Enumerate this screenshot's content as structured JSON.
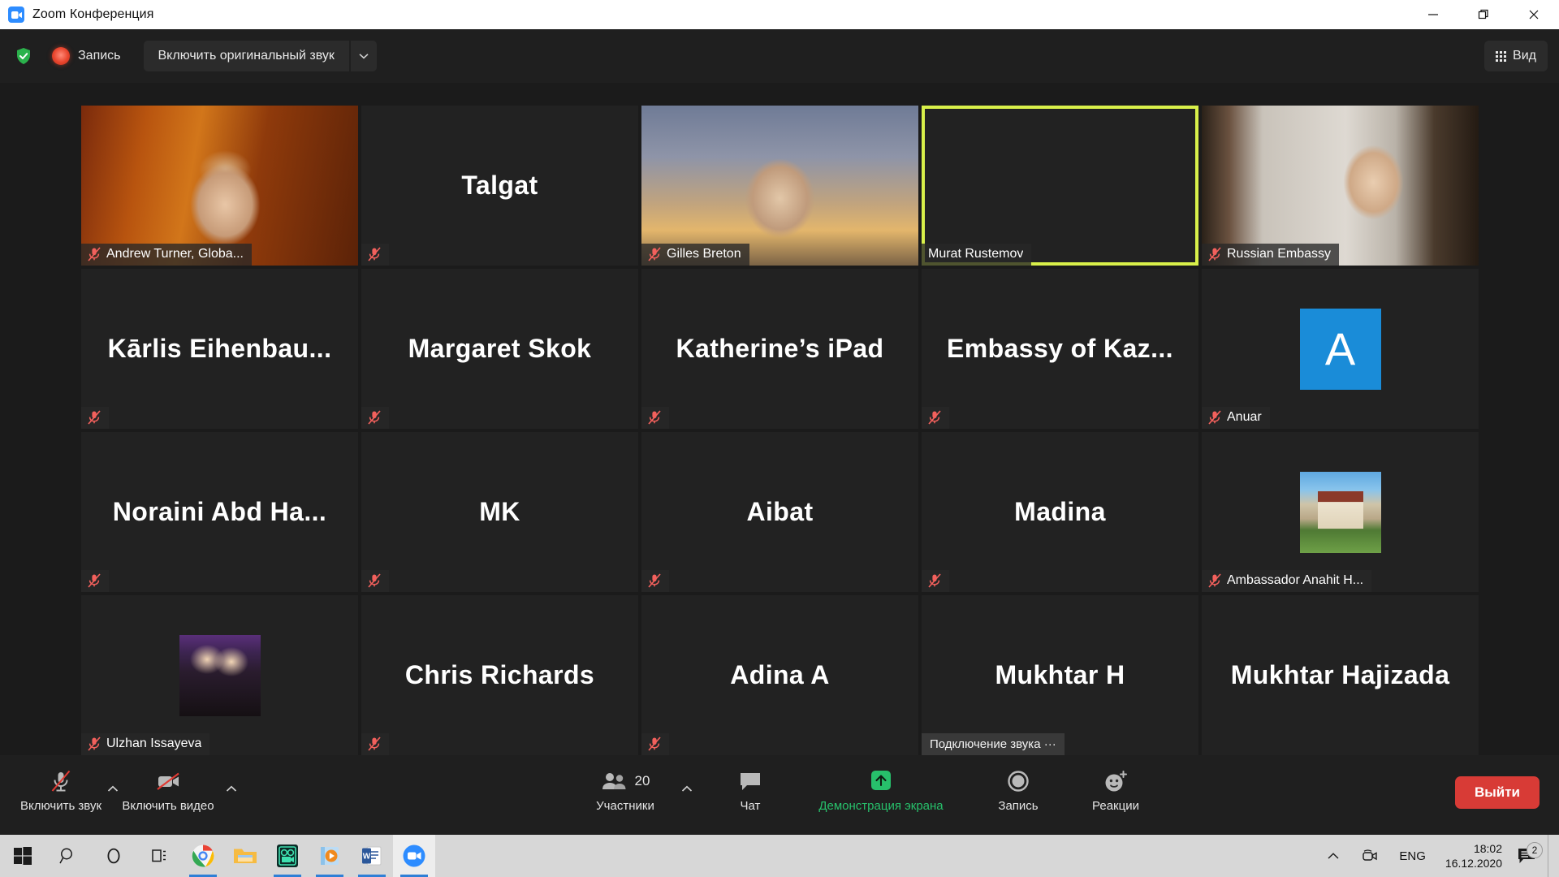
{
  "window": {
    "title": "Zoom Конференция",
    "app_icon": "zoom-camera-icon",
    "minimize_label": "Свернуть",
    "restore_label": "Развернуть",
    "close_label": "Закрыть"
  },
  "toolbar": {
    "shield_icon": "shield-check-icon",
    "recording_label": "Запись",
    "original_audio_label": "Включить оригинальный звук",
    "original_audio_caret_icon": "chevron-down-icon",
    "view_label": "Вид",
    "view_icon": "grid-icon"
  },
  "grid": {
    "columns": 5,
    "rows": 4,
    "speaker_border_color": "#d9f04a",
    "tile_bg": "#222222",
    "avatar_blue": "#1a8cd8",
    "participants": [
      {
        "name": "Andrew Turner, Globa...",
        "display": "video",
        "muted": true,
        "speaking": false,
        "bg": "bg-andrew"
      },
      {
        "name": "Talgat",
        "display": "name",
        "muted": true,
        "speaking": false
      },
      {
        "name": "Gilles Breton",
        "display": "video",
        "muted": true,
        "speaking": false,
        "bg": "bg-gilles"
      },
      {
        "name": "Murat Rustemov",
        "display": "video",
        "muted": false,
        "speaking": true,
        "bg": "bg-murat"
      },
      {
        "name": "Russian Embassy",
        "display": "video",
        "muted": true,
        "speaking": false,
        "bg": "bg-russian"
      },
      {
        "name": "Kārlis  Eihenbau...",
        "display": "name",
        "muted": true,
        "speaking": false
      },
      {
        "name": "Margaret Skok",
        "display": "name",
        "muted": true,
        "speaking": false
      },
      {
        "name": "Katherine’s iPad",
        "display": "name",
        "muted": true,
        "speaking": false
      },
      {
        "name": "Embassy  of  Kaz...",
        "display": "name",
        "muted": true,
        "speaking": false
      },
      {
        "name": "Anuar",
        "display": "avatar-letter",
        "letter": "A",
        "muted": true,
        "speaking": false
      },
      {
        "name": "Noraini  Abd  Ha...",
        "display": "name",
        "muted": true,
        "speaking": false
      },
      {
        "name": "MK",
        "display": "name",
        "muted": true,
        "speaking": false
      },
      {
        "name": "Aibat",
        "display": "name",
        "muted": true,
        "speaking": false
      },
      {
        "name": "Madina",
        "display": "name",
        "muted": true,
        "speaking": false
      },
      {
        "name": "Ambassador Anahit H...",
        "display": "avatar-photo",
        "photo": "bg-house",
        "muted": true,
        "speaking": false
      },
      {
        "name": "Ulzhan Issayeva",
        "display": "avatar-photo",
        "photo": "bg-ulzhan",
        "muted": true,
        "speaking": false
      },
      {
        "name": "Chris Richards",
        "display": "name",
        "muted": true,
        "speaking": false
      },
      {
        "name": "Adina A",
        "display": "name",
        "muted": true,
        "speaking": false
      },
      {
        "name": "Mukhtar H",
        "display": "name",
        "muted": false,
        "speaking": false,
        "status": "Подключение звука ···"
      },
      {
        "name": "Mukhtar Hajizada",
        "display": "name",
        "muted": false,
        "speaking": false
      }
    ]
  },
  "controls": {
    "audio_label": "Включить звук",
    "audio_icon": "microphone-muted-icon",
    "audio_caret_icon": "chevron-up-icon",
    "video_label": "Включить видео",
    "video_icon": "camera-muted-icon",
    "video_caret_icon": "chevron-up-icon",
    "participants_label": "Участники",
    "participants_count": "20",
    "participants_icon": "people-icon",
    "participants_caret_icon": "chevron-up-icon",
    "chat_label": "Чат",
    "chat_icon": "chat-bubble-icon",
    "share_label": "Демонстрация экрана",
    "share_icon": "share-screen-icon",
    "share_color": "#27c06b",
    "record_label": "Запись",
    "record_icon": "record-circle-icon",
    "reactions_label": "Реакции",
    "reactions_icon": "smiley-plus-icon",
    "leave_label": "Выйти",
    "leave_color": "#d83b36"
  },
  "taskbar": {
    "items": [
      {
        "name": "start-button",
        "icon": "windows-logo-icon",
        "running": false,
        "active": false
      },
      {
        "name": "search-button",
        "icon": "search-icon",
        "running": false,
        "active": false
      },
      {
        "name": "cortana-button",
        "icon": "cortana-circle-icon",
        "running": false,
        "active": false
      },
      {
        "name": "task-view-button",
        "icon": "task-view-icon",
        "running": false,
        "active": false
      },
      {
        "name": "chrome",
        "icon": "chrome-icon",
        "running": true,
        "active": false
      },
      {
        "name": "file-explorer",
        "icon": "folder-icon",
        "running": false,
        "active": false
      },
      {
        "name": "video-editor",
        "icon": "movie-camera-icon",
        "running": true,
        "active": false
      },
      {
        "name": "media-player",
        "icon": "media-player-icon",
        "running": true,
        "active": false
      },
      {
        "name": "word",
        "icon": "word-icon",
        "running": true,
        "active": false
      },
      {
        "name": "zoom",
        "icon": "zoom-camera-icon",
        "running": true,
        "active": true
      }
    ],
    "tray": {
      "overflow_icon": "chevron-up-icon",
      "camera_icon": "webcam-icon",
      "language": "ENG",
      "time": "18:02",
      "date": "16.12.2020",
      "notifications_icon": "notification-icon",
      "notifications_count": "2"
    }
  }
}
